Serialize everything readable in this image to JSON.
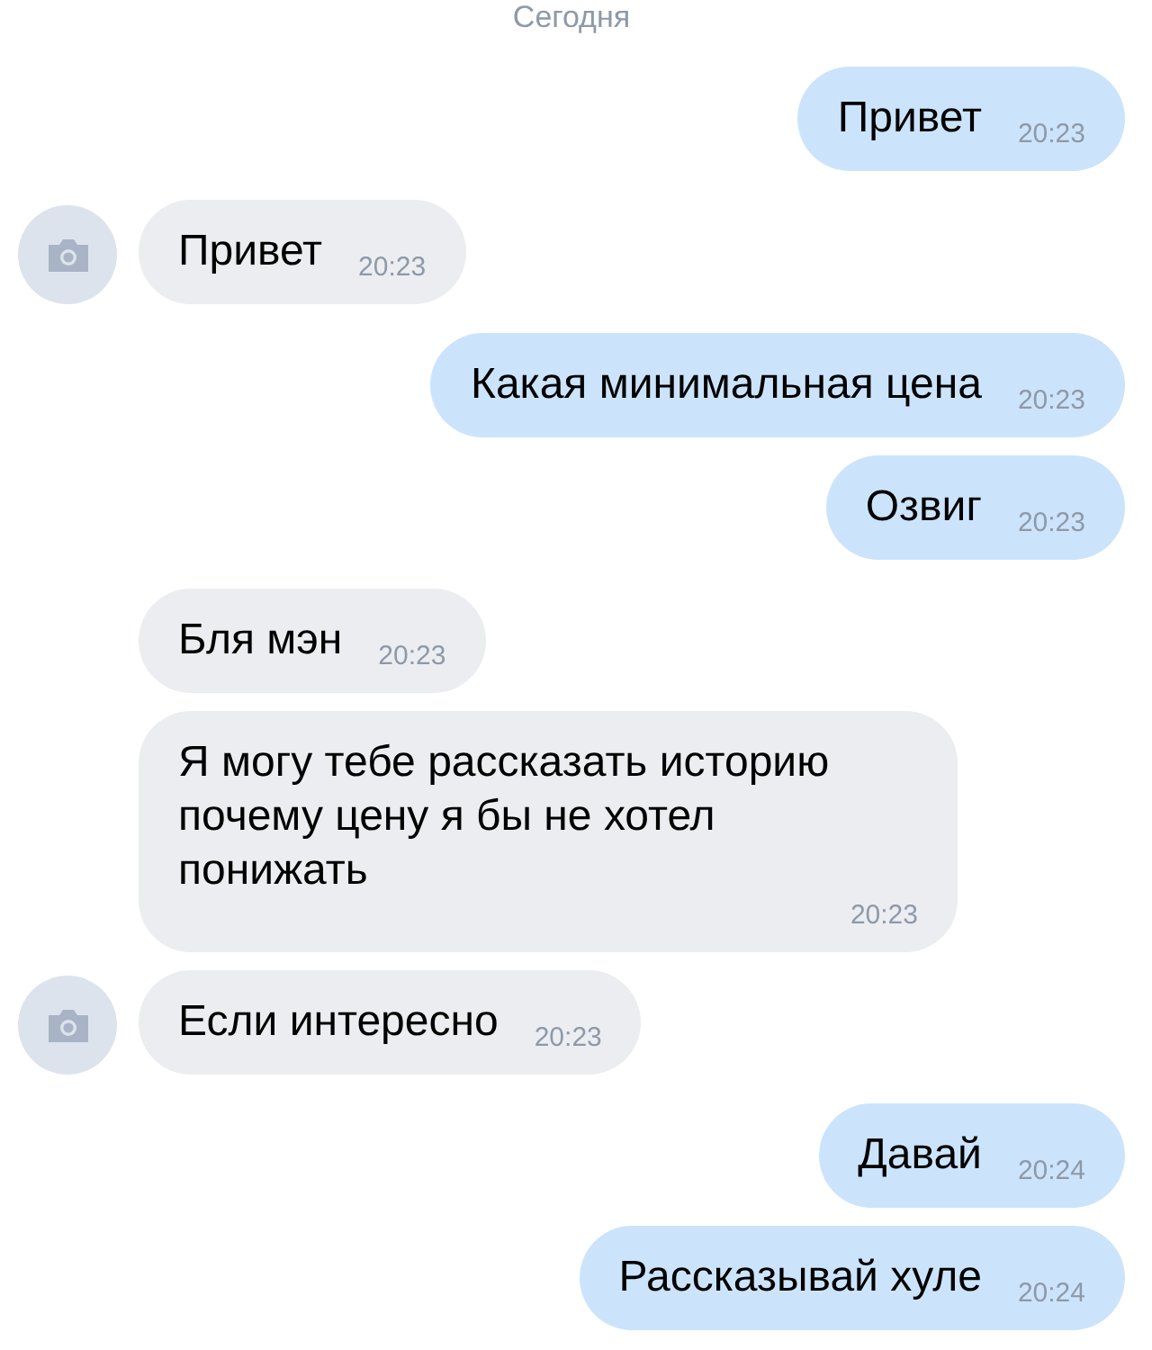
{
  "date_header": "Сегодня",
  "messages": [
    {
      "outgoing": true,
      "text": "Привет",
      "time": "20:23",
      "avatar": false
    },
    {
      "outgoing": false,
      "text": "Привет",
      "time": "20:23",
      "avatar": true
    },
    {
      "outgoing": true,
      "text": "Какая минимальная цена",
      "time": "20:23",
      "avatar": false
    },
    {
      "outgoing": true,
      "text": "Озвиг",
      "time": "20:23",
      "avatar": false
    },
    {
      "outgoing": false,
      "text": "Бля мэн",
      "time": "20:23",
      "avatar": false
    },
    {
      "outgoing": false,
      "text": "Я могу тебе рассказать историю почему цену я бы не хотел понижать",
      "time": "20:23",
      "avatar": false
    },
    {
      "outgoing": false,
      "text": "Если интересно",
      "time": "20:23",
      "avatar": true
    },
    {
      "outgoing": true,
      "text": "Давай",
      "time": "20:24",
      "avatar": false
    },
    {
      "outgoing": true,
      "text": "Рассказывай хуле",
      "time": "20:24",
      "avatar": false
    }
  ]
}
